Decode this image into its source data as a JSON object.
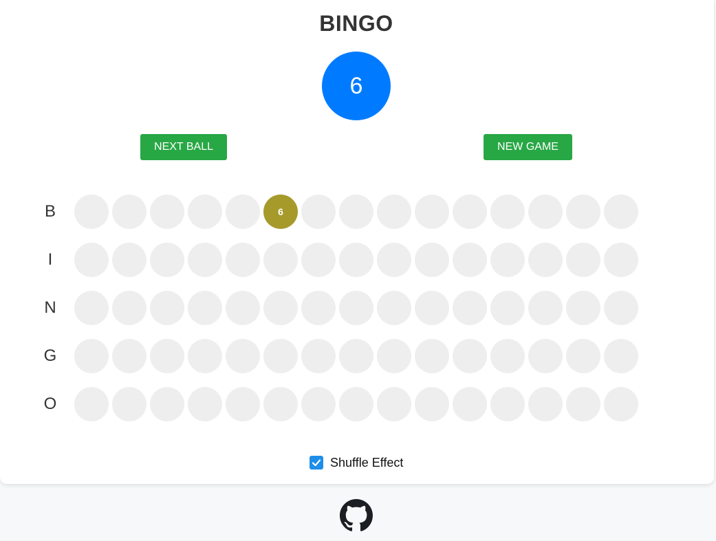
{
  "title": "BINGO",
  "current_ball": "6",
  "buttons": {
    "next_ball": "NEXT BALL",
    "new_game": "NEW GAME"
  },
  "board": {
    "rows": [
      {
        "letter": "B",
        "cells": [
          "",
          "",
          "",
          "",
          "",
          "6",
          "",
          "",
          "",
          "",
          "",
          "",
          "",
          "",
          ""
        ]
      },
      {
        "letter": "I",
        "cells": [
          "",
          "",
          "",
          "",
          "",
          "",
          "",
          "",
          "",
          "",
          "",
          "",
          "",
          "",
          ""
        ]
      },
      {
        "letter": "N",
        "cells": [
          "",
          "",
          "",
          "",
          "",
          "",
          "",
          "",
          "",
          "",
          "",
          "",
          "",
          "",
          ""
        ]
      },
      {
        "letter": "G",
        "cells": [
          "",
          "",
          "",
          "",
          "",
          "",
          "",
          "",
          "",
          "",
          "",
          "",
          "",
          "",
          ""
        ]
      },
      {
        "letter": "O",
        "cells": [
          "",
          "",
          "",
          "",
          "",
          "",
          "",
          "",
          "",
          "",
          "",
          "",
          "",
          "",
          ""
        ]
      }
    ]
  },
  "shuffle_effect": {
    "label": "Shuffle Effect",
    "checked": true
  },
  "footer": {
    "icon": "github-icon"
  },
  "colors": {
    "current_ball": "#007bff",
    "button": "#28a745",
    "called_cell": "#a69a2b",
    "empty_cell": "#eeeeee",
    "checkbox": "#1e8ee8"
  }
}
